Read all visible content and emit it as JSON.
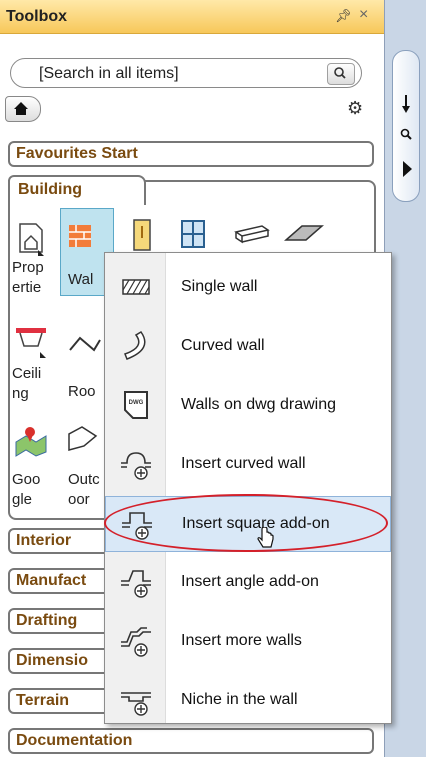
{
  "toolbox": {
    "title": "Toolbox",
    "pin_icon": "pin-icon",
    "close_label": "×",
    "search_placeholder": "[Search in all items]",
    "search_icon": "search-icon",
    "home_icon": "home-icon",
    "settings_icon": "gear-icon"
  },
  "categories": {
    "favourites": "Favourites Start",
    "building": "Building",
    "interior": "Interior",
    "manufacturers": "Manufact",
    "drafting": "Drafting",
    "dimensions": "Dimensio",
    "terrain": "Terrain",
    "documentation": "Documentation"
  },
  "tools": {
    "properties": [
      "Prop",
      "ertie"
    ],
    "walls": "Wal",
    "ceiling": [
      "Ceili",
      "ng"
    ],
    "roof": "Roo",
    "google": [
      "Goo",
      "gle"
    ],
    "outdoor": [
      "Outc",
      "oor"
    ]
  },
  "menu": {
    "items": [
      {
        "label": "Single wall",
        "icon": "hatched-wall-icon"
      },
      {
        "label": "Curved wall",
        "icon": "curved-wall-icon"
      },
      {
        "label": "Walls on dwg drawing",
        "icon": "dwg-icon"
      },
      {
        "label": "Insert curved wall",
        "icon": "insert-curved-wall-icon"
      },
      {
        "label": "Insert square add-on",
        "icon": "insert-square-addon-icon"
      },
      {
        "label": "Insert angle add-on",
        "icon": "insert-angle-addon-icon"
      },
      {
        "label": "Insert more walls",
        "icon": "insert-more-walls-icon"
      },
      {
        "label": "Niche in the wall",
        "icon": "niche-icon"
      }
    ],
    "highlighted_index": 4
  },
  "colors": {
    "title_bar": "#f7c85a",
    "category_text": "#7a4b10",
    "highlight": "#d9e8f7",
    "annotation": "#d4202a"
  }
}
